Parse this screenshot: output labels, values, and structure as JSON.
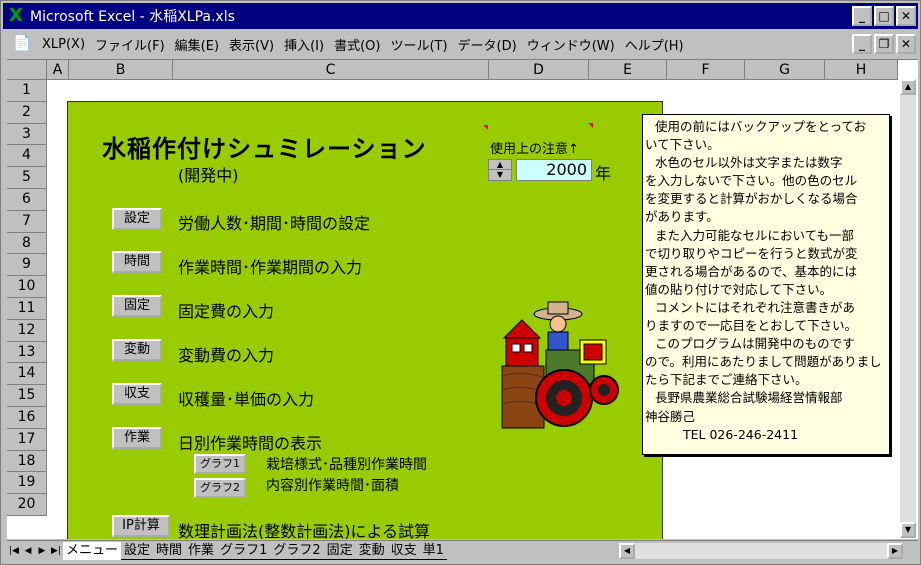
{
  "window": {
    "title": "Microsoft Excel - 水稲XLPa.xls",
    "app_icon": "excel-icon"
  },
  "menu": {
    "items": [
      "XLP(X)",
      "ファイル(F)",
      "編集(E)",
      "表示(V)",
      "挿入(I)",
      "書式(O)",
      "ツール(T)",
      "データ(D)",
      "ウィンドウ(W)",
      "ヘルプ(H)"
    ]
  },
  "columns": [
    "A",
    "B",
    "C",
    "D",
    "E",
    "F",
    "G",
    "H"
  ],
  "rows": [
    "1",
    "2",
    "3",
    "4",
    "5",
    "6",
    "7",
    "8",
    "9",
    "10",
    "11",
    "12",
    "13",
    "14",
    "15",
    "16",
    "17",
    "18",
    "19",
    "20"
  ],
  "sheet": {
    "heading": "水稲作付けシュミレーション",
    "subheading": "(開発中)",
    "notice_label": "使用上の注意↑",
    "year_value": "2000",
    "year_unit": "年",
    "buttons": [
      {
        "label": "設定",
        "desc": "労働人数･期間･時間の設定"
      },
      {
        "label": "時間",
        "desc": "作業時間･作業期間の入力"
      },
      {
        "label": "固定",
        "desc": "固定費の入力"
      },
      {
        "label": "変動",
        "desc": "変動費の入力"
      },
      {
        "label": "収支",
        "desc": "収穫量･単価の入力"
      },
      {
        "label": "作業",
        "desc": "日別作業時間の表示"
      },
      {
        "label": "IP計算",
        "desc": "数理計画法(整数計画法)による試算"
      }
    ],
    "graph_buttons": [
      {
        "label": "グラフ1",
        "desc": "栽培様式･品種別作業時間"
      },
      {
        "label": "グラフ2",
        "desc": "内容別作業時間･面積"
      }
    ]
  },
  "comment": {
    "lines": [
      "使用の前にはバックアップをとってお",
      "いて下さい。",
      "水色のセル以外は文字または数字",
      "を入力しないで下さい。他の色のセル",
      "を変更すると計算がおかしくなる場合",
      "があります。",
      "また入力可能なセルにおいても一部",
      "で切り取りやコピーを行うと数式が変",
      "更される場合があるので、基本的には",
      "値の貼り付けで対応して下さい。",
      "コメントにはそれぞれ注意書きがあ",
      "りますので一応目をとおして下さい。",
      "このプログラムは開発中のものです",
      "ので。利用にあたりまして問題がありまし",
      "たら下記までご連絡下さい。",
      "長野県農業総合試験場経営情報部",
      "神谷勝己",
      "TEL 026-246-2411"
    ]
  },
  "tabs": [
    "メニュー",
    "設定",
    "時間",
    "作業",
    "グラフ1",
    "グラフ2",
    "固定",
    "変動",
    "収支",
    "単1"
  ]
}
